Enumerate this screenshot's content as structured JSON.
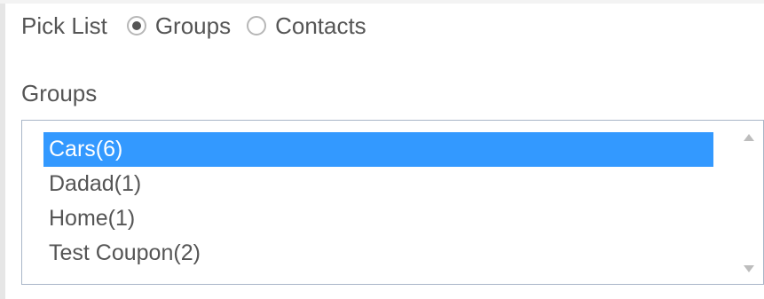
{
  "picklist": {
    "label": "Pick List",
    "options": [
      {
        "label": "Groups",
        "selected": true
      },
      {
        "label": "Contacts",
        "selected": false
      }
    ]
  },
  "groups": {
    "label": "Groups",
    "items": [
      "Cars(6)",
      "Dadad(1)",
      "Home(1)",
      "Test Coupon(2)"
    ],
    "selected_index": 0
  },
  "colors": {
    "selection_background": "#3399ff",
    "text": "#555555",
    "listbox_border": "#a9b6c8"
  },
  "icons": [
    "radio-selected-icon",
    "radio-unselected-icon",
    "scroll-up-arrow-icon",
    "scroll-down-arrow-icon"
  ]
}
